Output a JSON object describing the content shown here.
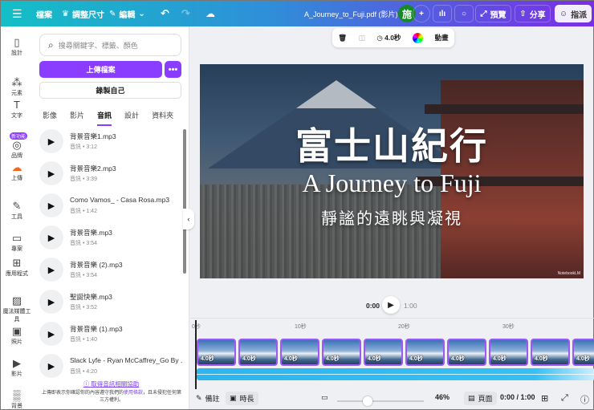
{
  "topbar": {
    "file": "檔案",
    "resize": "調整尺寸",
    "edit": "編輯",
    "title": "A_Journey_to_Fuji.pdf (影片)",
    "avatar": "施",
    "preview": "預覽",
    "share": "分享",
    "assign": "指派"
  },
  "rail": [
    {
      "label": "設計",
      "icon": "▯"
    },
    {
      "label": "元素",
      "icon": "⁂"
    },
    {
      "label": "文字",
      "icon": "T"
    },
    {
      "label": "品牌",
      "icon": "◎",
      "badge": "新功能"
    },
    {
      "label": "上傳",
      "icon": "☁"
    },
    {
      "label": "工具",
      "icon": "✎"
    },
    {
      "label": "專案",
      "icon": "▭"
    },
    {
      "label": "應用程式",
      "icon": "⊞"
    },
    {
      "label": "魔法媒體工具",
      "icon": "▨"
    },
    {
      "label": "照片",
      "icon": "▣"
    },
    {
      "label": "影片",
      "icon": "▶"
    },
    {
      "label": "背景",
      "icon": "▒"
    }
  ],
  "panel": {
    "search_placeholder": "搜尋關鍵字、標籤、顏色",
    "upload": "上傳檔案",
    "record": "錄製自己",
    "tabs": [
      "影像",
      "影片",
      "音訊",
      "設計",
      "資料夾"
    ],
    "items": [
      {
        "name": "背景音樂1.mp3",
        "meta": "音訊 • 3:12"
      },
      {
        "name": "背景音樂2.mp3",
        "meta": "音訊 • 3:39"
      },
      {
        "name": "Como Vamos_ - Casa Rosa.mp3",
        "meta": "音訊 • 1:42"
      },
      {
        "name": "背景音樂.mp3",
        "meta": "音訊 • 3:54"
      },
      {
        "name": "背景音樂 (2).mp3",
        "meta": "音訊 • 3:54"
      },
      {
        "name": "聖誕快樂.mp3",
        "meta": "音訊 • 3:52"
      },
      {
        "name": "背景音樂 (1).mp3",
        "meta": "音訊 • 1:40"
      },
      {
        "name": "Slack Lyfe - Ryan McCaffrey_Go By ...",
        "meta": "音訊 • 4:20"
      }
    ],
    "help": "取得音訊相關協助",
    "legal_pre": "上傳即表示你確認你的內容遵守我們的",
    "legal_link": "使用條款",
    "legal_post": "，且未侵犯任何第三方權利。"
  },
  "toolbar": {
    "duration": "4.0秒",
    "animate": "動畫"
  },
  "slide": {
    "title": "富士山紀行",
    "subtitle": "A Journey to Fuji",
    "tagline": "靜謐的遠眺與凝視",
    "watermark": "NotebookLM"
  },
  "player": {
    "current": "0:00",
    "total": "1:00"
  },
  "ruler": [
    "0秒",
    "10秒",
    "20秒",
    "30秒"
  ],
  "clips": [
    "4.0秒",
    "4.0秒",
    "4.0秒",
    "4.0秒",
    "4.0秒",
    "4.0秒",
    "4.0秒",
    "4.0秒",
    "4.0秒",
    "4.0秒"
  ],
  "bottom": {
    "notes": "備註",
    "duration": "時長",
    "zoom": "46%",
    "zoom_fraction": 0.35,
    "pages": "頁面",
    "time": "0:00 / 1:00"
  }
}
